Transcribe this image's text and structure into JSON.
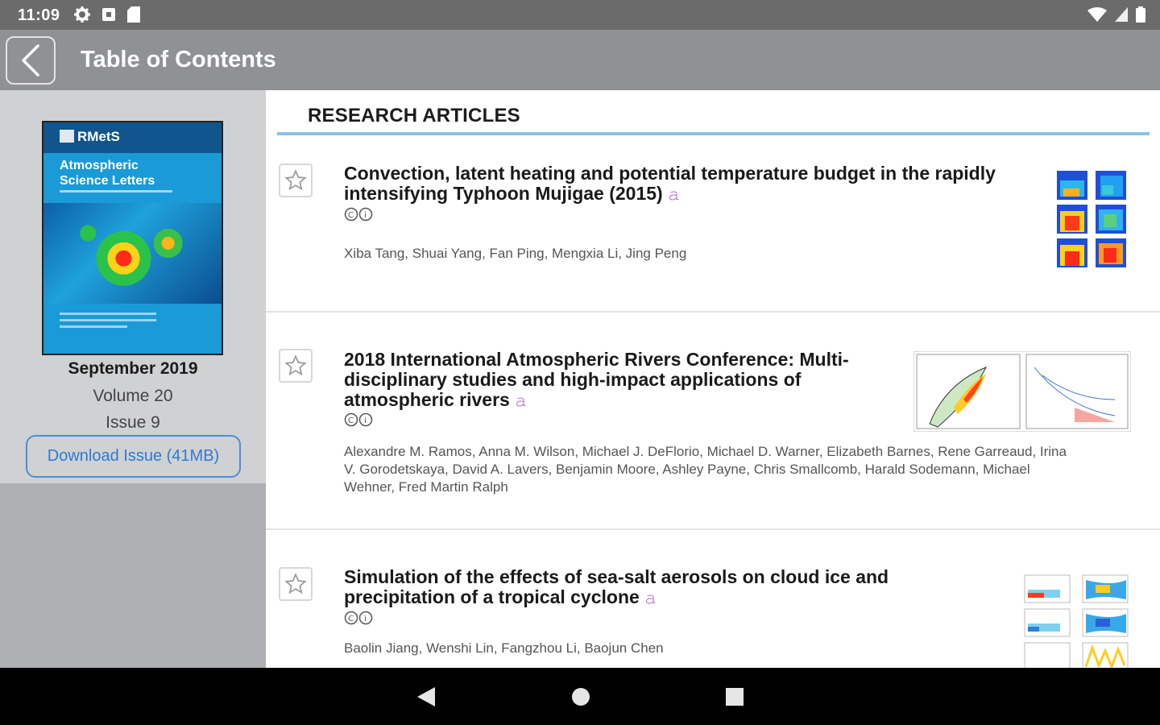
{
  "status_bar": {
    "time": "11:09",
    "left_icons": [
      "gear-icon",
      "notification-icon",
      "sd-card-icon"
    ],
    "right_icons": [
      "wifi-icon",
      "signal-icon",
      "battery-icon"
    ]
  },
  "app_bar": {
    "title": "Table of Contents",
    "back_icon": "chevron-left-icon"
  },
  "issue": {
    "cover_logo": "RMetS",
    "cover_title_line1": "Atmospheric",
    "cover_title_line2": "Science Letters",
    "date": "September 2019",
    "volume": "Volume 20",
    "issue": "Issue 9",
    "download_label": "Download Issue (41MB)"
  },
  "main": {
    "section_heading": "RESEARCH ARTICLES",
    "articles": [
      {
        "title_line1": "Convection, latent heating and potential temperature budget in the rapidly",
        "title_line2": "intensifying Typhoon Mujigae (2015)",
        "license": "ⒸⓘⒸ",
        "authors_line1": "Xiba Tang, Shuai Yang, Fan Ping, Mengxia Li, Jing Peng"
      },
      {
        "title_line1": "2018 International Atmospheric Rivers Conference: Multi-",
        "title_line2": "disciplinary studies and high-impact applications of",
        "title_line3": "atmospheric rivers",
        "license": "ⒸⓘⒸ",
        "authors_line1": "Alexandre M. Ramos, Anna M. Wilson, Michael J. DeFlorio, Michael D. Warner, Elizabeth Barnes, Rene Garreaud, Irina",
        "authors_line2": "V. Gorodetskaya, David A. Lavers, Benjamin Moore, Ashley Payne, Chris Smallcomb, Harald Sodemann, Michael",
        "authors_line3": "Wehner, Fred Martin Ralph"
      },
      {
        "title_line1": "Simulation of the effects of sea-salt aerosols on cloud ice and",
        "title_line2": "precipitation of a tropical cyclone",
        "license": "ⒸⓘⒸ",
        "authors_line1": "Baolin Jiang, Wenshi Lin, Fangzhou Li, Baojun Chen"
      }
    ]
  },
  "nav_bar": {
    "back": "nav-back-icon",
    "home": "nav-home-icon",
    "recents": "nav-recents-icon"
  },
  "colors": {
    "status_bar": "#6b6b6b",
    "app_bar": "#8f9195",
    "sidebar": "#d0d1d3",
    "accent_rule": "#8cc3e6",
    "download_border": "#4f8ed4",
    "lock_icon": "#b06cc4"
  }
}
